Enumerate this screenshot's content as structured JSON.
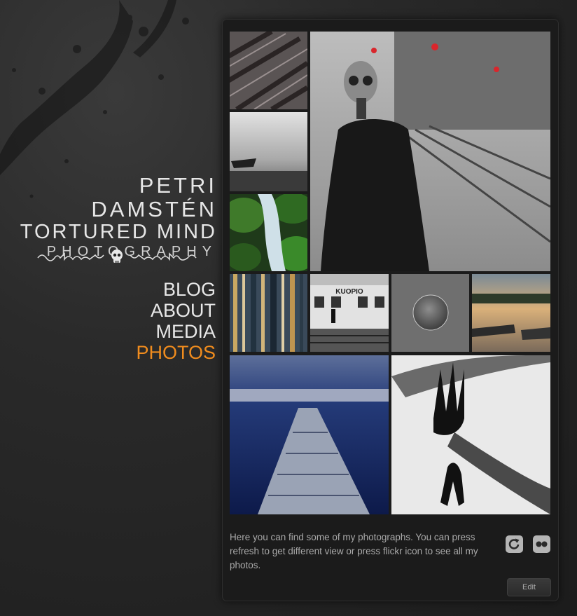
{
  "brand": {
    "name": "PETRI DAMSTÉN",
    "tagline": "TORTURED MIND",
    "subtitle": "PHOTOGRAPHY"
  },
  "nav": {
    "items": [
      {
        "label": "BLOG",
        "active": false
      },
      {
        "label": "ABOUT",
        "active": false
      },
      {
        "label": "MEDIA",
        "active": false
      },
      {
        "label": "PHOTOS",
        "active": true
      }
    ]
  },
  "accent_color": "#f08c1e",
  "gallery": {
    "photos": [
      "railway-tracks-rain-photo",
      "misty-lake-boat-photo",
      "forest-stream-photo",
      "gas-mask-man-platform-photo",
      "blurred-trees-photo",
      "kuopio-station-photo",
      "glass-sphere-photo",
      "lake-sunset-boats-photo",
      "pier-blue-lake-photo",
      "shadow-hands-photo"
    ],
    "description": "Here you can find some of my photographs. You can press refresh to get different view or press flickr icon to see all my photos.",
    "station_sign": "KUOPIO"
  },
  "actions": {
    "refresh_icon": "refresh-icon",
    "flickr_icon": "flickr-icon",
    "edit_label": "Edit"
  }
}
